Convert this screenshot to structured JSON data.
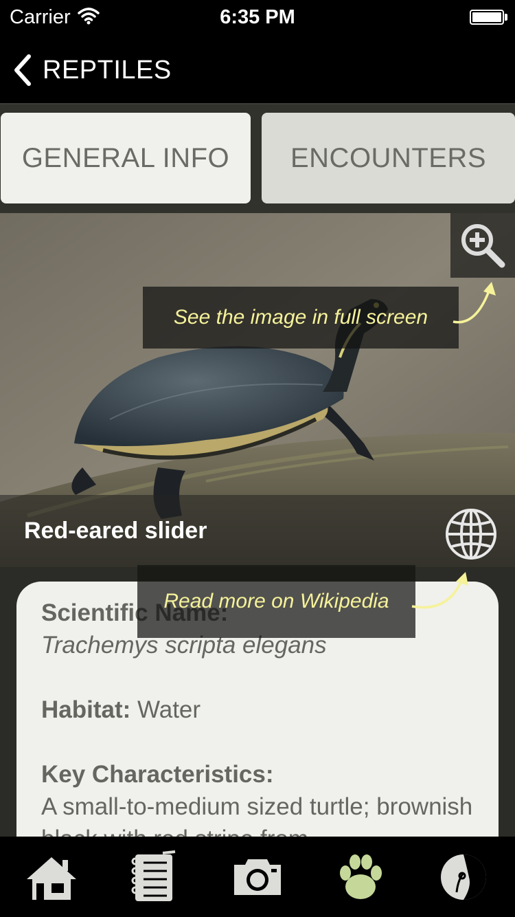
{
  "status_bar": {
    "carrier": "Carrier",
    "time": "6:35 PM"
  },
  "nav": {
    "back_label": "REPTILES"
  },
  "tabs": [
    {
      "label": "GENERAL INFO",
      "selected": true
    },
    {
      "label": "ENCOUNTERS",
      "selected": false
    }
  ],
  "hints": {
    "fullscreen": "See the image in full screen",
    "wikipedia": "Read more on Wikipedia"
  },
  "animal": {
    "name": "Red-eared slider",
    "scientific_label": "Scientific Name:",
    "scientific_name": "Trachemys scripta elegans",
    "habitat_label": "Habitat:",
    "habitat": " Water",
    "key_label": "Key Characteristics:",
    "key_text": "A small-to-medium sized turtle; brownish black with red stripe from"
  },
  "tab_bar": {
    "items": [
      {
        "icon": "home-icon",
        "active": false
      },
      {
        "icon": "notebook-icon",
        "active": false
      },
      {
        "icon": "camera-icon",
        "active": false
      },
      {
        "icon": "paw-icon",
        "active": true
      },
      {
        "icon": "logo-icon",
        "active": false
      }
    ],
    "active_color": "#c5d89a"
  },
  "colors": {
    "hint_text": "#f6f29a"
  }
}
